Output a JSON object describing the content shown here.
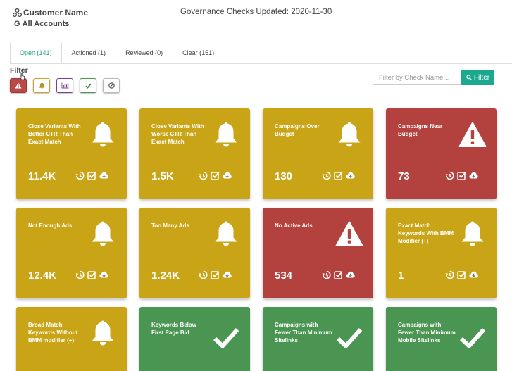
{
  "header": {
    "customer": "Customer Name",
    "accounts": "All Accounts",
    "governance_label": "Governance Checks Updated: 2020-11-30"
  },
  "tabs": [
    {
      "label": "Open (141)",
      "active": true
    },
    {
      "label": "Actioned (1)",
      "active": false
    },
    {
      "label": "Reviewed (0)",
      "active": false
    },
    {
      "label": "Clear (151)",
      "active": false
    }
  ],
  "filter": {
    "label": "Filter",
    "buttons": [
      "warning-icon",
      "bell-icon",
      "chart-icon",
      "check-icon",
      "ban-icon"
    ],
    "search_placeholder": "Filter by Check Name...",
    "search_button": "Filter"
  },
  "colors": {
    "yellow": "#c9a417",
    "red": "#b3423f",
    "green": "#4a9551",
    "accent": "#1aa88e"
  },
  "cards": [
    {
      "title": "Close Variants With Better CTR Than Exact Match",
      "value": "11.4K",
      "color": "yellow",
      "icon": "bell-icon"
    },
    {
      "title": "Close Variants With Worse CTR Than Exact Match",
      "value": "1.5K",
      "color": "yellow",
      "icon": "bell-icon"
    },
    {
      "title": "Campaigns Over Budget",
      "value": "130",
      "color": "yellow",
      "icon": "bell-icon"
    },
    {
      "title": "Campaigns Near Budget",
      "value": "73",
      "color": "red",
      "icon": "warning-icon"
    },
    {
      "title": "Not Enough Ads",
      "value": "12.4K",
      "color": "yellow",
      "icon": "bell-icon"
    },
    {
      "title": "Too Many Ads",
      "value": "1.24K",
      "color": "yellow",
      "icon": "bell-icon"
    },
    {
      "title": "No Active Ads",
      "value": "534",
      "color": "red",
      "icon": "warning-icon"
    },
    {
      "title": "Exact Match Keywords With BMM Modifier (+)",
      "value": "1",
      "color": "yellow",
      "icon": "bell-icon"
    },
    {
      "title": "Broad Match Keywords Without BMM modifier (+)",
      "value": "",
      "color": "yellow",
      "icon": "bell-icon"
    },
    {
      "title": "Keywords Below First Page Bid",
      "value": "",
      "color": "green",
      "icon": "check-icon"
    },
    {
      "title": "Campaigns with Fewer Than Minimum Sitelinks",
      "value": "",
      "color": "green",
      "icon": "check-icon"
    },
    {
      "title": "Campaigns with Fewer Than Minimum Mobile Sitelinks",
      "value": "",
      "color": "green",
      "icon": "check-icon"
    }
  ]
}
